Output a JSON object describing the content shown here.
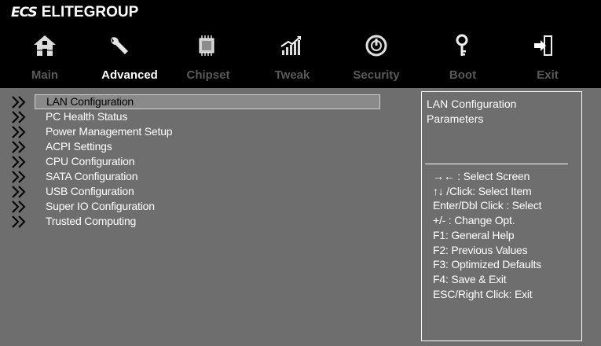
{
  "brand": {
    "logo": "ECS",
    "name": "ELITEGROUP"
  },
  "tabs": [
    {
      "label": "Main",
      "icon": "home-icon",
      "active": false
    },
    {
      "label": "Advanced",
      "icon": "wrench-icon",
      "active": true
    },
    {
      "label": "Chipset",
      "icon": "chip-icon",
      "active": false
    },
    {
      "label": "Tweak",
      "icon": "tweak-chart-icon",
      "active": false
    },
    {
      "label": "Security",
      "icon": "security-icon",
      "active": false
    },
    {
      "label": "Boot",
      "icon": "key-icon",
      "active": false
    },
    {
      "label": "Exit",
      "icon": "exit-icon",
      "active": false
    }
  ],
  "menu": {
    "items": [
      {
        "label": "LAN Configuration",
        "selected": true
      },
      {
        "label": "PC Health Status",
        "selected": false
      },
      {
        "label": "Power Management Setup",
        "selected": false
      },
      {
        "label": "ACPI Settings",
        "selected": false
      },
      {
        "label": "CPU Configuration",
        "selected": false
      },
      {
        "label": "SATA Configuration",
        "selected": false
      },
      {
        "label": "USB Configuration",
        "selected": false
      },
      {
        "label": "Super IO Configuration",
        "selected": false
      },
      {
        "label": "Trusted Computing",
        "selected": false
      }
    ]
  },
  "help": {
    "description": "LAN Configuration Parameters",
    "keys": [
      "→←   : Select Screen",
      "↑↓ /Click: Select Item",
      "Enter/Dbl Click : Select",
      "+/- : Change Opt.",
      "F1: General Help",
      "F2: Previous Values",
      "F3: Optimized Defaults",
      "F4: Save & Exit",
      "ESC/Right Click: Exit"
    ]
  },
  "colors": {
    "background": "#6e6e6e",
    "header": "#000000",
    "inactive_tab": "#5a5a5a",
    "active_tab": "#ffffff",
    "selected_row": "#8a8a8a"
  }
}
